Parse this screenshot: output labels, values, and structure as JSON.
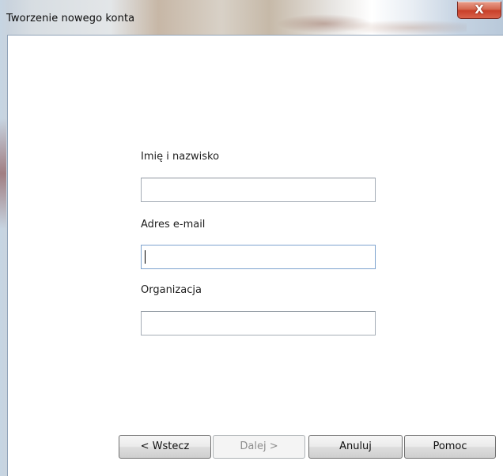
{
  "window": {
    "title": "Tworzenie nowego konta",
    "close_icon": "x-icon",
    "close_glyph": "X"
  },
  "form": {
    "name_label": "Imię i nazwisko",
    "name_value": "",
    "email_label": "Adres e-mail",
    "email_value": "",
    "org_label": "Organizacja",
    "org_value": ""
  },
  "buttons": {
    "back": "< Wstecz",
    "next": "Dalej >",
    "cancel": "Anuluj",
    "help": "Pomoc"
  }
}
